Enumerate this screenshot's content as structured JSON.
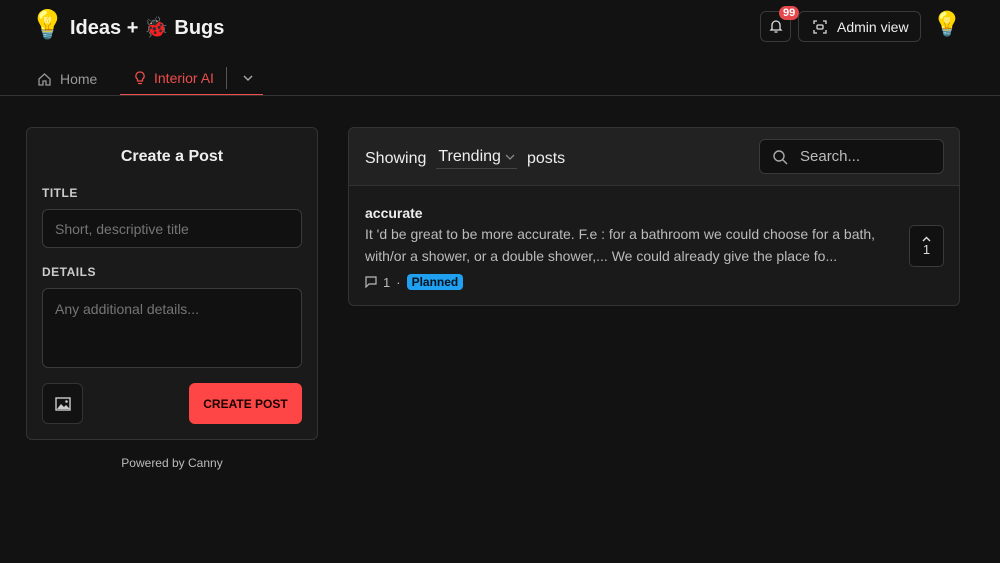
{
  "header": {
    "brand": "Ideas + 🐞 Bugs",
    "logo": "💡",
    "notification_count": "99",
    "admin_label": "Admin view",
    "avatar": "💡"
  },
  "nav": {
    "home": "Home",
    "active": "Interior AI"
  },
  "create": {
    "heading": "Create a Post",
    "title_label": "TITLE",
    "title_placeholder": "Short, descriptive title",
    "details_label": "DETAILS",
    "details_placeholder": "Any additional details...",
    "submit": "CREATE POST"
  },
  "powered": "Powered by Canny",
  "posts": {
    "showing": "Showing",
    "sort": "Trending",
    "suffix": "posts",
    "search_placeholder": "Search...",
    "items": [
      {
        "title": "accurate",
        "body": "It 'd be great to be more accurate. F.e : for a bathroom we could choose for a bath, with/or a shower, or a double shower,... We could already give the place fo...",
        "comments": "1",
        "status": "Planned",
        "votes": "1"
      }
    ]
  },
  "colors": {
    "accent": "#ef4d4d",
    "planned": "#1fa0f0",
    "button": "#ff4646"
  }
}
